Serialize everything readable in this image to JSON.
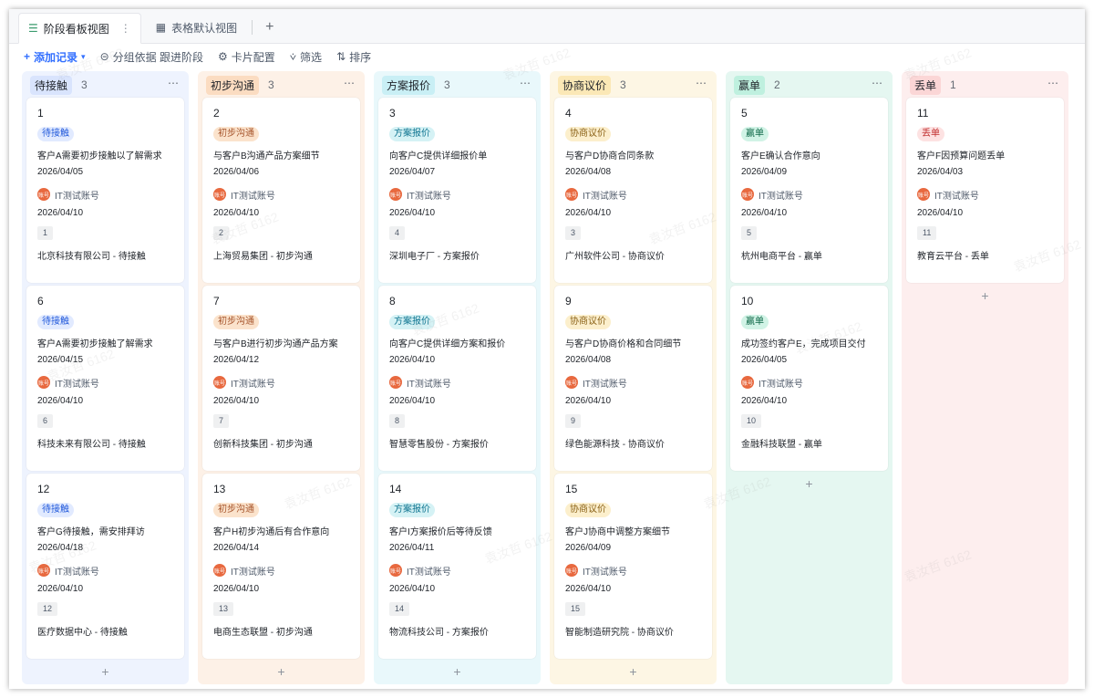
{
  "tabs": [
    {
      "label": "阶段看板视图",
      "icon": "kanban-icon",
      "active": true
    },
    {
      "label": "表格默认视图",
      "icon": "table-icon",
      "active": false
    }
  ],
  "toolbar": {
    "add_record": "添加记录",
    "group_by": "分组依据 跟进阶段",
    "card_config": "卡片配置",
    "filter": "筛选",
    "sort": "排序"
  },
  "owner": "IT测试账号",
  "avatar_text": "账号",
  "watermark": "袁汝哲 6162",
  "columns": [
    {
      "name": "待接触",
      "count": "3",
      "color": "blue",
      "cards": [
        {
          "num": "1",
          "tag": "待接触",
          "title": "客户A需要初步接触以了解需求",
          "date1": "2026/04/05",
          "date2": "2026/04/10",
          "idx": "1",
          "company": "北京科技有限公司 - 待接触"
        },
        {
          "num": "6",
          "tag": "待接触",
          "title": "客户A需要初步接触了解需求",
          "date1": "2026/04/15",
          "date2": "2026/04/10",
          "idx": "6",
          "company": "科技未来有限公司 - 待接触"
        },
        {
          "num": "12",
          "tag": "待接触",
          "title": "客户G待接触，需安排拜访",
          "date1": "2026/04/18",
          "date2": "2026/04/10",
          "idx": "12",
          "company": "医疗数据中心 - 待接触"
        }
      ]
    },
    {
      "name": "初步沟通",
      "count": "3",
      "color": "orange",
      "cards": [
        {
          "num": "2",
          "tag": "初步沟通",
          "title": "与客户B沟通产品方案细节",
          "date1": "2026/04/06",
          "date2": "2026/04/10",
          "idx": "2",
          "company": "上海贸易集团 - 初步沟通"
        },
        {
          "num": "7",
          "tag": "初步沟通",
          "title": "与客户B进行初步沟通产品方案",
          "date1": "2026/04/12",
          "date2": "2026/04/10",
          "idx": "7",
          "company": "创新科技集团 - 初步沟通"
        },
        {
          "num": "13",
          "tag": "初步沟通",
          "title": "客户H初步沟通后有合作意向",
          "date1": "2026/04/14",
          "date2": "2026/04/10",
          "idx": "13",
          "company": "电商生态联盟 - 初步沟通"
        }
      ]
    },
    {
      "name": "方案报价",
      "count": "3",
      "color": "cyan",
      "cards": [
        {
          "num": "3",
          "tag": "方案报价",
          "title": "向客户C提供详细报价单",
          "date1": "2026/04/07",
          "date2": "2026/04/10",
          "idx": "4",
          "company": "深圳电子厂 - 方案报价"
        },
        {
          "num": "8",
          "tag": "方案报价",
          "title": "向客户C提供详细方案和报价",
          "date1": "2026/04/10",
          "date2": "2026/04/10",
          "idx": "8",
          "company": "智慧零售股份 - 方案报价"
        },
        {
          "num": "14",
          "tag": "方案报价",
          "title": "客户I方案报价后等待反馈",
          "date1": "2026/04/11",
          "date2": "2026/04/10",
          "idx": "14",
          "company": "物流科技公司 - 方案报价"
        }
      ]
    },
    {
      "name": "协商议价",
      "count": "3",
      "color": "yellow",
      "cards": [
        {
          "num": "4",
          "tag": "协商议价",
          "title": "与客户D协商合同条款",
          "date1": "2026/04/08",
          "date2": "2026/04/10",
          "idx": "3",
          "company": "广州软件公司 - 协商议价"
        },
        {
          "num": "9",
          "tag": "协商议价",
          "title": "与客户D协商价格和合同细节",
          "date1": "2026/04/08",
          "date2": "2026/04/10",
          "idx": "9",
          "company": "绿色能源科技 - 协商议价"
        },
        {
          "num": "15",
          "tag": "协商议价",
          "title": "客户J协商中调整方案细节",
          "date1": "2026/04/09",
          "date2": "2026/04/10",
          "idx": "15",
          "company": "智能制造研究院 - 协商议价"
        }
      ]
    },
    {
      "name": "赢单",
      "count": "2",
      "color": "teal",
      "cards": [
        {
          "num": "5",
          "tag": "赢单",
          "title": "客户E确认合作意向",
          "date1": "2026/04/09",
          "date2": "2026/04/10",
          "idx": "5",
          "company": "杭州电商平台 - 赢单"
        },
        {
          "num": "10",
          "tag": "赢单",
          "title": "成功签约客户E，完成项目交付",
          "date1": "2026/04/05",
          "date2": "2026/04/10",
          "idx": "10",
          "company": "金融科技联盟 - 赢单"
        }
      ]
    },
    {
      "name": "丢单",
      "count": "1",
      "color": "red",
      "cards": [
        {
          "num": "11",
          "tag": "丢单",
          "title": "客户F因预算问题丢单",
          "date1": "2026/04/03",
          "date2": "2026/04/10",
          "idx": "11",
          "company": "教育云平台 - 丢单"
        }
      ]
    }
  ]
}
